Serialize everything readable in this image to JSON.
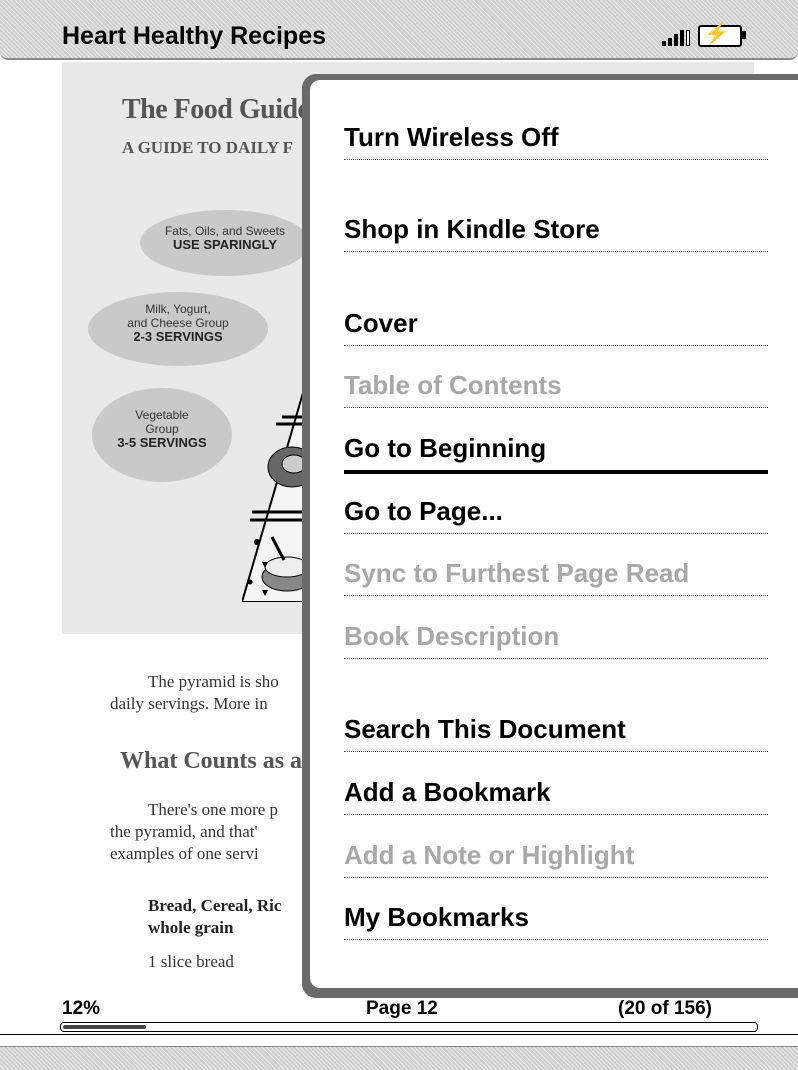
{
  "header": {
    "book_title": "Heart Healthy Recipes",
    "signal_icon": "signal-strength-icon",
    "battery_icon": "battery-charging-icon"
  },
  "page": {
    "graphic_heading": "The Food Guide P",
    "graphic_subheading": "A GUIDE TO DAILY F",
    "bubbles": [
      {
        "line1": "Fats, Oils, and Sweets",
        "line2": "",
        "bold": "USE SPARINGLY"
      },
      {
        "line1": "Milk, Yogurt,",
        "line2": "and Cheese Group",
        "bold": "2-3 SERVINGS"
      },
      {
        "line1": "Vegetable",
        "line2": "Group",
        "bold": "3-5 SERVINGS"
      }
    ],
    "paragraph1_line1": "The pyramid is sho",
    "paragraph1_line2": "daily servings.  More in",
    "section_heading": "What Counts as a",
    "paragraph2_line1": "There's one more p",
    "paragraph2_line2": "the pyramid, and that'",
    "paragraph2_line3": "examples of one servi",
    "food_group_line1": "Bread, Cereal, Ric",
    "food_group_line2": "whole grain",
    "serving_example": "1 slice bread"
  },
  "menu": {
    "items": [
      {
        "label": "Turn Wireless Off",
        "enabled": true
      },
      {
        "label": "Shop in Kindle Store",
        "enabled": true
      },
      {
        "label": "Cover",
        "enabled": true
      },
      {
        "label": "Table of Contents",
        "enabled": false
      },
      {
        "label": "Go to Beginning",
        "enabled": true,
        "selected": true
      },
      {
        "label": "Go to Page...",
        "enabled": true
      },
      {
        "label": "Sync to Furthest Page Read",
        "enabled": false
      },
      {
        "label": "Book Description",
        "enabled": false
      },
      {
        "label": "Search This Document",
        "enabled": true
      },
      {
        "label": "Add a Bookmark",
        "enabled": true
      },
      {
        "label": "Add a Note or Highlight",
        "enabled": false
      },
      {
        "label": "My Bookmarks",
        "enabled": true
      }
    ]
  },
  "footer": {
    "percent": "12%",
    "page": "Page 12",
    "location": "(20 of 156)",
    "progress_fraction": 0.12
  }
}
